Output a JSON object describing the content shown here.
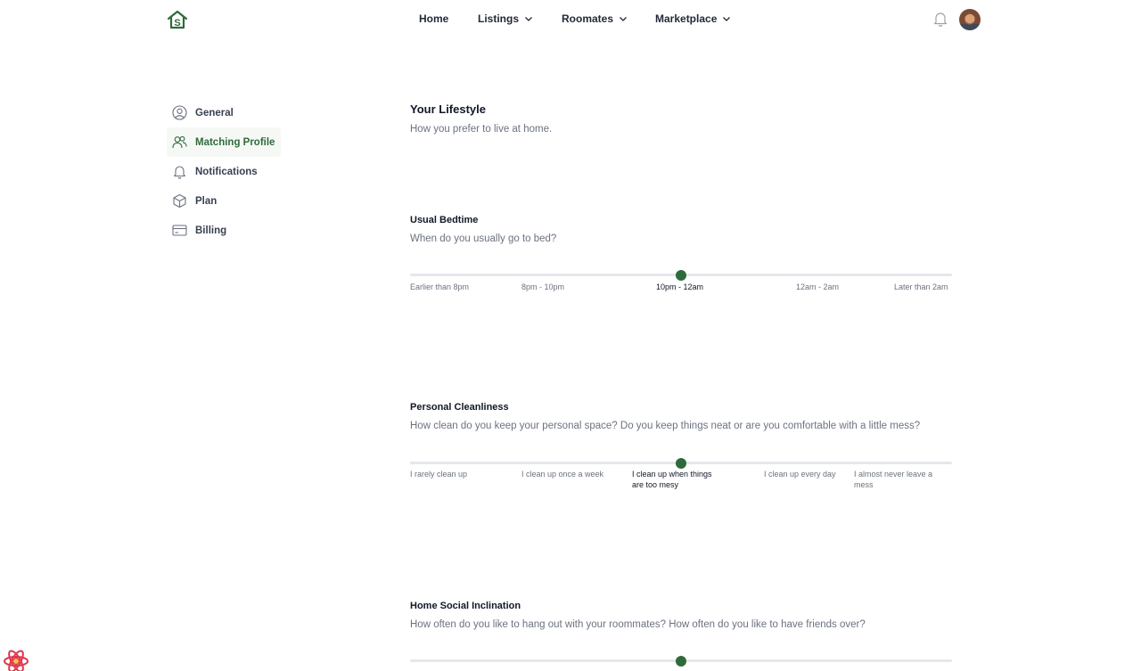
{
  "header": {
    "nav": [
      {
        "label": "Home",
        "dropdown": false
      },
      {
        "label": "Listings",
        "dropdown": true
      },
      {
        "label": "Roomates",
        "dropdown": true
      },
      {
        "label": "Marketplace",
        "dropdown": true
      }
    ],
    "brand_color": "#2f6b3a"
  },
  "sidebar": {
    "items": [
      {
        "label": "General",
        "icon": "user-circle-icon",
        "active": false
      },
      {
        "label": "Matching Profile",
        "icon": "users-icon",
        "active": true
      },
      {
        "label": "Notifications",
        "icon": "bell-icon",
        "active": false
      },
      {
        "label": "Plan",
        "icon": "cube-icon",
        "active": false
      },
      {
        "label": "Billing",
        "icon": "credit-card-icon",
        "active": false
      }
    ]
  },
  "lifestyle": {
    "title": "Your Lifestyle",
    "description": "How you prefer to live at home."
  },
  "bedtime": {
    "title": "Usual Bedtime",
    "description": "When do you usually go to bed?",
    "options": [
      "Earlier than 8pm",
      "8pm - 10pm",
      "10pm - 12am",
      "12am - 2am",
      "Later than 2am"
    ],
    "selected_index": 2
  },
  "cleanliness": {
    "title": "Personal Cleanliness",
    "description": "How clean do you keep your personal space? Do you keep things neat or are you comfortable with a little mess?",
    "options": [
      "I rarely clean up",
      "I clean up once a week",
      "I clean up when things are too mesy",
      "I clean up every day",
      "I almost never leave a mess"
    ],
    "selected_index": 2
  },
  "social": {
    "title": "Home Social Inclination",
    "description": "How often do you like to hang out with your roommates? How often do you like to have friends over?",
    "selected_index": 2
  }
}
